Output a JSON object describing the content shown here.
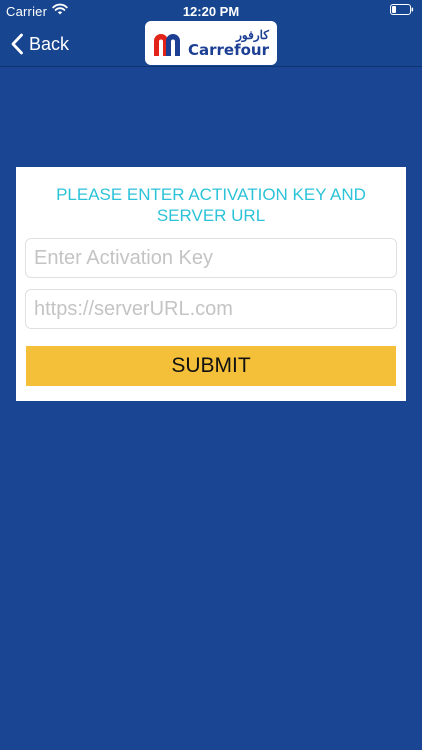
{
  "status_bar": {
    "carrier": "Carrier",
    "time": "12:20 PM"
  },
  "nav": {
    "back_label": "Back",
    "logo": {
      "arabic": "كارفور",
      "latin": "Carrefour"
    }
  },
  "form": {
    "title_line1": "PLEASE ENTER ACTIVATION KEY AND",
    "title_line2": "SERVER URL",
    "activation_key": {
      "value": "",
      "placeholder": "Enter Activation Key"
    },
    "server_url": {
      "value": "",
      "placeholder": "https://serverURL.com"
    },
    "submit_label": "SUBMIT"
  },
  "colors": {
    "background": "#1a4592",
    "title": "#2cc3d9",
    "submit": "#f4c03a",
    "logo_red": "#e2231a",
    "logo_blue": "#1c3f94"
  },
  "icons": [
    "wifi-icon",
    "battery-icon",
    "chevron-left-icon",
    "carrefour-logo-icon"
  ]
}
